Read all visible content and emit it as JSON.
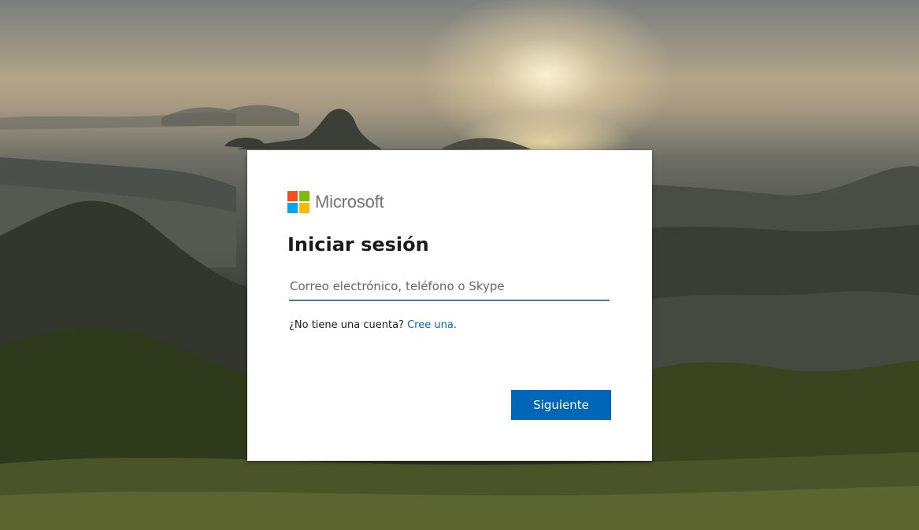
{
  "brand": {
    "name": "Microsoft",
    "logo_colors": [
      "#f25022",
      "#7fba00",
      "#00a4ef",
      "#ffb900"
    ]
  },
  "signin": {
    "title": "Iniciar sesión",
    "input_placeholder": "Correo electrónico, teléfono o Skype",
    "input_value": "",
    "no_account_text": "¿No tiene una cuenta?",
    "create_link": "Cree una.",
    "next_button": "Siguiente"
  },
  "colors": {
    "accent": "#0067b8",
    "input_underline": "#4a79a8"
  },
  "background": {
    "description_icon": "landscape-image"
  }
}
